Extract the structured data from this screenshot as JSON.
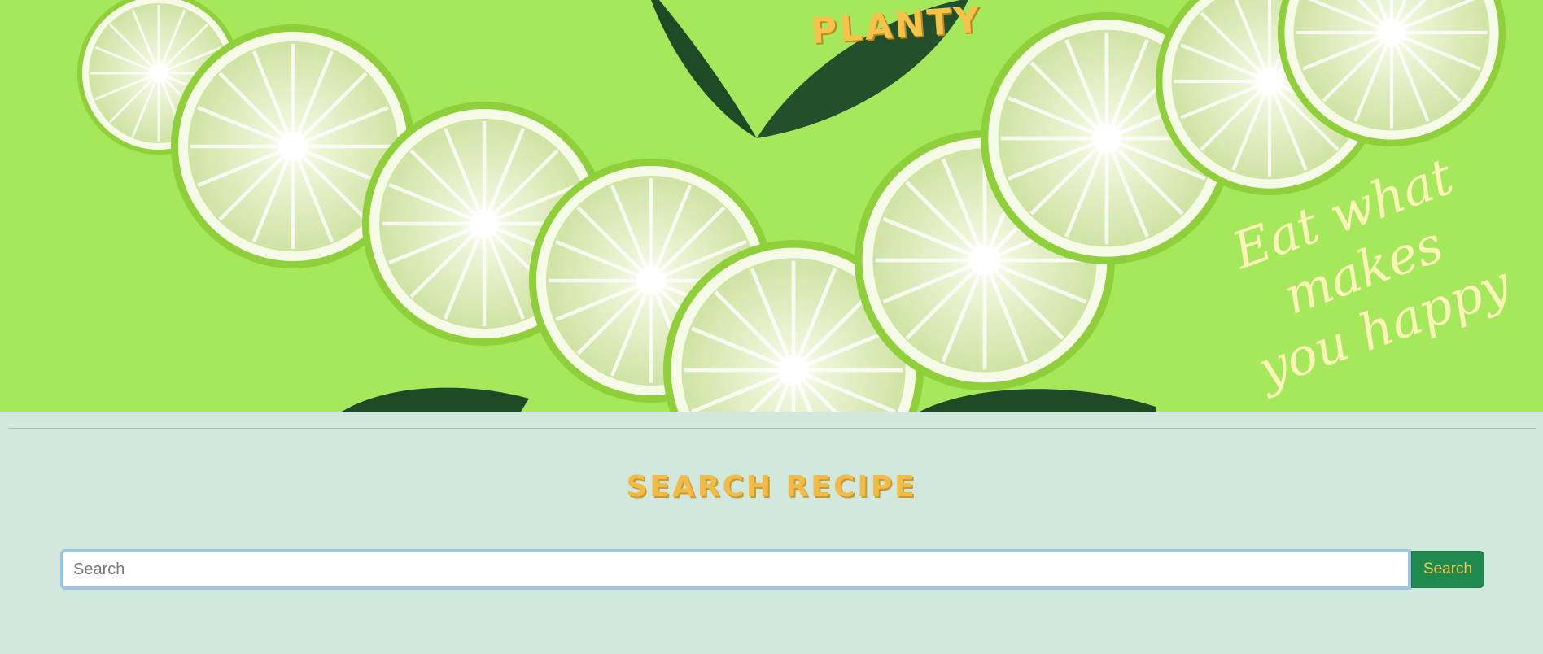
{
  "hero": {
    "brand": "PLANTY",
    "tagline_line1": "Eat what makes",
    "tagline_line2": "you happy",
    "background_color": "#a6e85c"
  },
  "section": {
    "title": "SEARCH RECIPE"
  },
  "search": {
    "placeholder": "Search",
    "value": "",
    "button_label": "Search"
  }
}
